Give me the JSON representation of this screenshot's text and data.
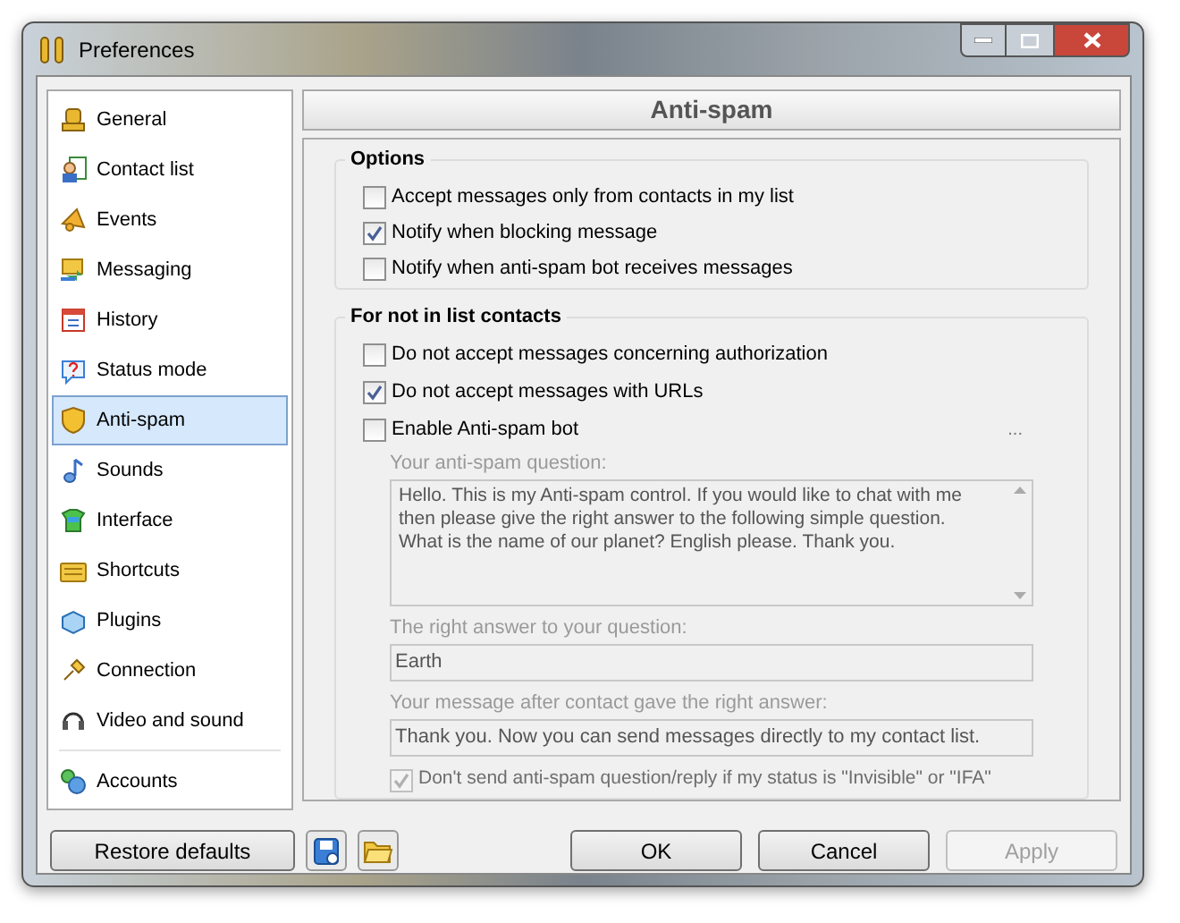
{
  "window": {
    "title": "Preferences"
  },
  "sidebar": {
    "items": [
      {
        "label": "General",
        "selected": false
      },
      {
        "label": "Contact list",
        "selected": false
      },
      {
        "label": "Events",
        "selected": false
      },
      {
        "label": "Messaging",
        "selected": false
      },
      {
        "label": "History",
        "selected": false
      },
      {
        "label": "Status mode",
        "selected": false
      },
      {
        "label": "Anti-spam",
        "selected": true
      },
      {
        "label": "Sounds",
        "selected": false
      },
      {
        "label": "Interface",
        "selected": false
      },
      {
        "label": "Shortcuts",
        "selected": false
      },
      {
        "label": "Plugins",
        "selected": false
      },
      {
        "label": "Connection",
        "selected": false
      },
      {
        "label": "Video and sound",
        "selected": false
      }
    ],
    "bottom_items": [
      {
        "label": "Accounts",
        "selected": false
      }
    ]
  },
  "header": "Anti-spam",
  "options": {
    "title": "Options",
    "checkboxes": [
      {
        "label": "Accept messages only from contacts in my list",
        "checked": false
      },
      {
        "label": "Notify when blocking message",
        "checked": true
      },
      {
        "label": "Notify when anti-spam bot receives messages",
        "checked": false
      }
    ]
  },
  "not_in_list": {
    "title": "For not in list contacts",
    "checkboxes": [
      {
        "label": "Do not accept messages concerning authorization",
        "checked": false
      },
      {
        "label": "Do not accept messages with URLs",
        "checked": true
      },
      {
        "label": "Enable Anti-spam bot",
        "checked": false
      }
    ],
    "more_button": "...",
    "bot": {
      "disabled": true,
      "question_label": "Your anti-spam question:",
      "question_text": "Hello. This is my Anti-spam control. If you would like to chat with me then please give the right answer to the following simple question. What is the name of our planet? English please. Thank you.",
      "answer_label": "The right answer to your question:",
      "answer_value": "Earth",
      "reply_label": "Your message after contact gave the right answer:",
      "reply_value": "Thank you. Now you can send messages directly to my contact list.",
      "invisible_checkbox": {
        "label": "Don't send anti-spam question/reply if my status is \"Invisible\" or \"IFA\"",
        "checked": true
      }
    }
  },
  "buttons": {
    "restore": {
      "label": "Restore defaults"
    },
    "ok": {
      "label": "OK"
    },
    "cancel": {
      "label": "Cancel"
    },
    "apply": {
      "label": "Apply",
      "disabled": true
    }
  }
}
